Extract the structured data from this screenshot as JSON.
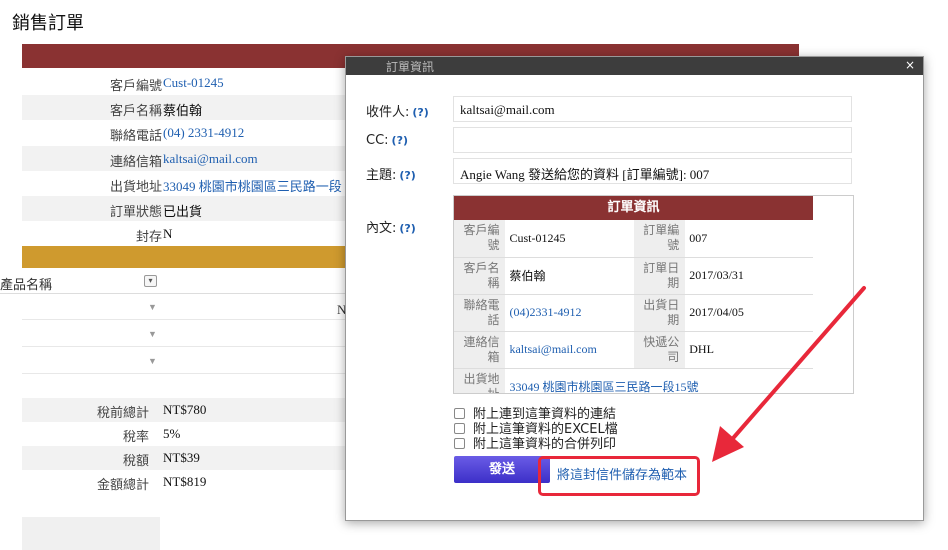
{
  "page": {
    "title": "銷售訂單"
  },
  "background": {
    "section_bar": "",
    "fields": [
      {
        "label": "客戶編號",
        "value": "Cust-01245",
        "link": true
      },
      {
        "label": "客戶名稱",
        "value": "蔡伯翰",
        "link": false
      },
      {
        "label": "聯絡電話",
        "value": "(04) 2331-4912",
        "link": true
      },
      {
        "label": "連絡信箱",
        "value": "kaltsai@mail.com",
        "link": true
      },
      {
        "label": "出貨地址",
        "value": "33049 桃園市桃園區三民路一段",
        "link": true
      },
      {
        "label": "訂單狀態",
        "value": "已出貨",
        "link": false
      },
      {
        "label": "封存",
        "value": "N",
        "link": false
      }
    ],
    "grid": {
      "column": "產品名稱",
      "n_value": "N"
    },
    "summary": [
      {
        "label": "稅前總計",
        "value": "NT$780"
      },
      {
        "label": "稅率",
        "value": "5%"
      },
      {
        "label": "稅額",
        "value": "NT$39"
      },
      {
        "label": "金額總計",
        "value": "NT$819"
      }
    ]
  },
  "dialog": {
    "header_text": "訂單資訊",
    "close_label": "×",
    "help_label": "(?)",
    "to_label": "收件人:",
    "to_value": "kaltsai@mail.com",
    "cc_label": "CC:",
    "cc_value": "",
    "subject_label": "主題:",
    "subject_value": "Angie Wang 發送給您的資料 [訂單編號]: 007",
    "body_label": "內文:",
    "body": {
      "title": "訂單資訊",
      "rows": [
        {
          "l1": "客戶編號",
          "v1": "Cust-01245",
          "l2": "訂單編號",
          "v2": "007"
        },
        {
          "l1": "客戶名稱",
          "v1": "蔡伯翰",
          "l2": "訂單日期",
          "v2": "2017/03/31"
        },
        {
          "l1": "聯絡電話",
          "v1": "(04)2331-4912",
          "l2": "出貨日期",
          "v2": "2017/04/05"
        },
        {
          "l1": "連絡信箱",
          "v1": "kaltsai@mail.com",
          "l2": "快遞公司",
          "v2": "DHL"
        },
        {
          "l1": "出貨地址",
          "v1": "33049 桃園市桃園區三民路一段15號"
        }
      ]
    },
    "checkboxes": [
      "附上連到這筆資料的連結",
      "附上這筆資料的EXCEL檔",
      "附上這筆資料的合併列印"
    ],
    "send_label": "發送",
    "save_template_label": "將這封信件儲存為範本"
  },
  "colors": {
    "section_bar": "#8a3232",
    "gold_bar": "#cf9a2e",
    "link": "#1f5fb0",
    "send_button": "#4636d4",
    "annotation": "#e8283a"
  }
}
